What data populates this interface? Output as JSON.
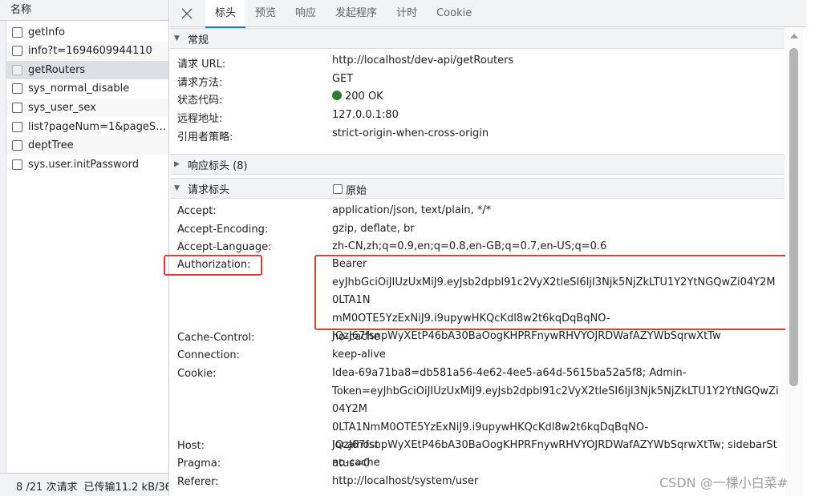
{
  "request_list": {
    "header": "名称",
    "items": [
      {
        "name": "getInfo"
      },
      {
        "name": "info?t=1694609944110"
      },
      {
        "name": "getRouters"
      },
      {
        "name": "sys_normal_disable"
      },
      {
        "name": "sys_user_sex"
      },
      {
        "name": "list?pageNum=1&pageSiz..."
      },
      {
        "name": "deptTree"
      },
      {
        "name": "sys.user.initPassword"
      }
    ],
    "selected": "getRouters"
  },
  "status_bar": {
    "requests": "8 /21 次请求",
    "transferred": "已传输11.2 kB/36."
  },
  "tabs": [
    "标头",
    "预览",
    "响应",
    "发起程序",
    "计时",
    "Cookie"
  ],
  "active_tab": "标头",
  "general": {
    "title": "常规",
    "rows": [
      {
        "key": "请求 URL:",
        "value": "http://localhost/dev-api/getRouters"
      },
      {
        "key": "请求方法:",
        "value": "GET"
      },
      {
        "key": "状态代码:",
        "value": "200 OK"
      },
      {
        "key": "远程地址:",
        "value": "127.0.0.1:80"
      },
      {
        "key": "引用者策略:",
        "value": "strict-origin-when-cross-origin"
      }
    ]
  },
  "response_headers": {
    "title": "响应标头 (8)",
    "expanded": false
  },
  "request_headers": {
    "title": "请求标头",
    "raw_label": "原始",
    "rows": [
      {
        "key": "Accept:",
        "value": "application/json, text/plain, */*"
      },
      {
        "key": "Accept-Encoding:",
        "value": "gzip, deflate, br"
      },
      {
        "key": "Accept-Language:",
        "value": "zh-CN,zh;q=0.9,en;q=0.8,en-GB;q=0.7,en-US;q=0.6"
      },
      {
        "key": "Authorization:",
        "value": "Bearer eyJhbGciOiJIUzUxMiJ9.eyJsb2dpbl91c2VyX2tleSI6IjI3Njk5NjZkLTU1Y2YtNGQwZi04Y2M0LTA1NmM0OTE5YzExNiJ9.i9upywHKQcKdl8w2t6kqDqBqNO-JQzJ67fsnpWyXEtP46bA30BaOogKHPRFnywRHVYOJRDWafAZYWbSqrwXtTw"
      },
      {
        "key": "Cache-Control:",
        "value": "no-cache"
      },
      {
        "key": "Connection:",
        "value": "keep-alive"
      },
      {
        "key": "Cookie:",
        "value": "Idea-69a71ba8=db581a56-4e62-4ee5-a64d-5615ba52a5f8; Admin-Token=eyJhbGciOiJIUzUxMiJ9.eyJsb2dpbl91c2VyX2tleSI6IjI3Njk5NjZkLTU1Y2YtNGQwZi04Y2M0LTA1NmM0OTE5YzExNiJ9.i9upywHKQcKdl8w2t6kqDqBqNO-JQzJ67fsnpWyXEtP46bA30BaOogKHPRFnywRHVYOJRDWafAZYWbSqrwXtTw; sidebarStatus=0"
      },
      {
        "key": "Host:",
        "value": "localhost"
      },
      {
        "key": "Pragma:",
        "value": "no-cache"
      },
      {
        "key": "Referer:",
        "value": "http://localhost/system/user"
      }
    ]
  },
  "auth_lines": [
    "Bearer",
    "eyJhbGciOiJIUzUxMiJ9.eyJsb2dpbl91c2VyX2tleSI6IjI3Njk5NjZkLTU1Y2YtNGQwZi04Y2M0LTA1N",
    "mM0OTE5YzExNiJ9.i9upywHKQcKdl8w2t6kqDqBqNO-",
    "JQzJ67fsnpWyXEtP46bA30BaOogKHPRFnywRHVYOJRDWafAZYWbSqrwXtTw"
  ],
  "cookie_lines": [
    "Idea-69a71ba8=db581a56-4e62-4ee5-a64d-5615ba52a5f8; Admin-",
    "Token=eyJhbGciOiJIUzUxMiJ9.eyJsb2dpbl91c2VyX2tleSI6IjI3Njk5NjZkLTU1Y2YtNGQwZi04Y2M",
    "0LTA1NmM0OTE5YzExNiJ9.i9upywHKQcKdl8w2t6kqDqBqNO-",
    "JQzJ67fsnpWyXEtP46bA30BaOogKHPRFnywRHVYOJRDWafAZYWbSqrwXtTw; sidebarStatus=0"
  ],
  "status_color": "#2e7d32",
  "highlight_color": "#e53935",
  "watermark": "CSDN @一棵小白菜#"
}
